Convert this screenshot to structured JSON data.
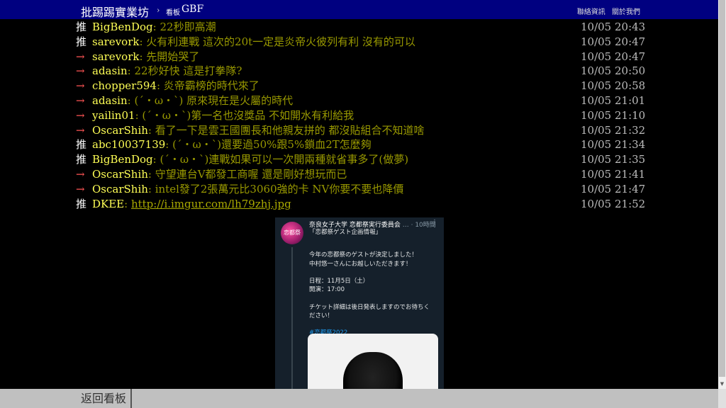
{
  "header": {
    "site_name": "批踢踢實業坊",
    "crumb_sep": "›",
    "crumb_label": "看板",
    "board_name": "GBF",
    "links": [
      "聯絡資訊",
      "關於我們"
    ]
  },
  "pushes": [
    {
      "tag": "推",
      "user": "BigBenDog",
      "content": ": 22秒即高潮",
      "time": "10/05 20:43"
    },
    {
      "tag": "推",
      "user": "sarevork",
      "content": ": 火有利連戰 這次的20t一定是炎帝火彼列有利 沒有的可以",
      "time": "10/05 20:47"
    },
    {
      "tag": "→",
      "user": "sarevork",
      "content": ": 先開始哭了",
      "time": "10/05 20:47"
    },
    {
      "tag": "→",
      "user": "adasin",
      "content": ": 22秒好快 這是打拳隊?",
      "time": "10/05 20:50"
    },
    {
      "tag": "→",
      "user": "chopper594",
      "content": ": 炎帝霸榜的時代來了",
      "time": "10/05 20:58"
    },
    {
      "tag": "→",
      "user": "adasin",
      "content": ": (´・ω・`) 原來現在是火屬的時代",
      "time": "10/05 21:01"
    },
    {
      "tag": "→",
      "user": "yailin01",
      "content": ": (´・ω・`)第一名也沒獎品 不如開水有利給我",
      "time": "10/05 21:10"
    },
    {
      "tag": "→",
      "user": "OscarShih",
      "content": ": 看了一下是雲王國團長和他親友拼的 都沒貼組合不知道啥",
      "time": "10/05 21:32"
    },
    {
      "tag": "推",
      "user": "abc10037139",
      "content": ": (´・ω・`)還要過50%跟5%鎖血2T怎麼夠",
      "time": "10/05 21:34"
    },
    {
      "tag": "推",
      "user": "BigBenDog",
      "content": ": (´・ω・`)連戰如果可以一次開兩種就省事多了(做夢)",
      "time": "10/05 21:35"
    },
    {
      "tag": "→",
      "user": "OscarShih",
      "content": ": 守望連台V都發工商喔 還是剛好想玩而已",
      "time": "10/05 21:41"
    },
    {
      "tag": "→",
      "user": "OscarShih",
      "content": ": intel發了2張萬元比3060強的卡 NV你要不要也降價",
      "time": "10/05 21:47"
    },
    {
      "tag": "推",
      "user": "DKEE",
      "content_prefix": ": ",
      "link": "http://i.imgur.com/lh79zhj.jpg",
      "time": "10/05 21:52"
    }
  ],
  "embed": {
    "avatar_text": "恋都祭",
    "account": "奈良女子大学 恋都祭実行委員会",
    "meta": "… · 10時間",
    "menu": "⋮",
    "lines": [
      "「恋都祭ゲスト企画情報」",
      "",
      "今年の恋都祭のゲストが決定しました！",
      "中村悠一さんにお越しいただきます！",
      "",
      "日程：11月5日（土）",
      "開演：17:00",
      "",
      "チケット詳細は後日発表しますのでお待ちく",
      "ださい！",
      "",
      "#恋都祭2022"
    ]
  },
  "footer": {
    "back_label": "返回看板"
  },
  "colors": {
    "topbar_bg": "#000080",
    "user": "#ffff55",
    "content": "#999900",
    "arrow": "#ff5555"
  }
}
